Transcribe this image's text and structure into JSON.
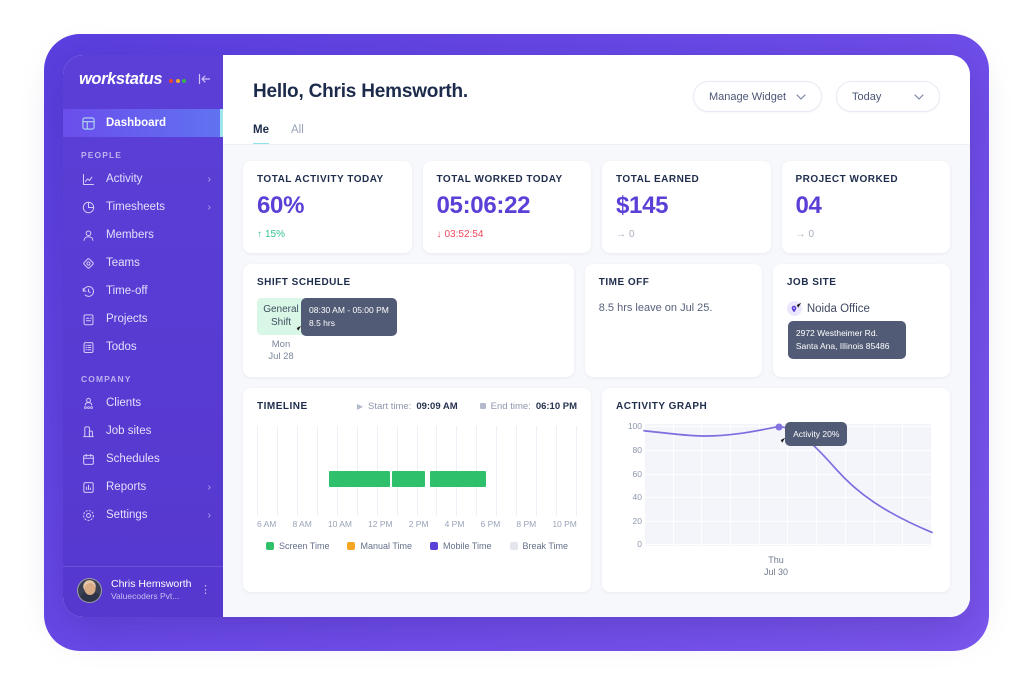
{
  "sidebar": {
    "brand": "workstatus",
    "brand_dot_colors": [
      "#e8452c",
      "#f0a72c",
      "#39b54a"
    ],
    "collapse_icon": "collapse-panel-icon",
    "active_item": "Dashboard",
    "items": [
      {
        "label": "Dashboard",
        "icon": "dashboard-icon",
        "active": true,
        "chevron": false
      },
      {
        "label": "Activity",
        "icon": "activity-chart-icon",
        "active": false,
        "chevron": true
      },
      {
        "label": "Timesheets",
        "icon": "pie-clock-icon",
        "active": false,
        "chevron": true
      },
      {
        "label": "Members",
        "icon": "user-icon",
        "active": false,
        "chevron": false
      },
      {
        "label": "Teams",
        "icon": "teams-icon",
        "active": false,
        "chevron": false
      },
      {
        "label": "Time-off",
        "icon": "clock-rewind-icon",
        "active": false,
        "chevron": false
      },
      {
        "label": "Projects",
        "icon": "clipboard-icon",
        "active": false,
        "chevron": false
      },
      {
        "label": "Todos",
        "icon": "list-icon",
        "active": false,
        "chevron": false
      },
      {
        "label": "Clients",
        "icon": "clients-icon",
        "active": false,
        "chevron": false
      },
      {
        "label": "Job sites",
        "icon": "building-icon",
        "active": false,
        "chevron": false
      },
      {
        "label": "Schedules",
        "icon": "calendar-icon",
        "active": false,
        "chevron": false
      },
      {
        "label": "Reports",
        "icon": "bar-report-icon",
        "active": false,
        "chevron": true
      },
      {
        "label": "Settings",
        "icon": "gear-icon",
        "active": false,
        "chevron": true
      }
    ],
    "sections": {
      "people": "PEOPLE",
      "company": "COMPANY"
    },
    "user": {
      "name": "Chris Hemsworth",
      "org": "Valuecoders Pvt...",
      "menu_icon": "more-vertical-icon"
    }
  },
  "header": {
    "greeting": "Hello, Chris Hemsworth.",
    "manage_widget": "Manage Widget",
    "date_range": "Today",
    "chevron_icon": "chevron-down-icon",
    "tabs": [
      {
        "label": "Me",
        "active": true
      },
      {
        "label": "All",
        "active": false
      }
    ]
  },
  "stats": [
    {
      "title": "TOTAL ACTIVITY TODAY",
      "value": "60%",
      "delta": "15%",
      "trend": "up"
    },
    {
      "title": "TOTAL WORKED TODAY",
      "value": "05:06:22",
      "delta": "03:52:54",
      "trend": "down"
    },
    {
      "title": "TOTAL EARNED",
      "value": "$145",
      "delta": "0",
      "trend": "flat"
    },
    {
      "title": "PROJECT WORKED",
      "value": "04",
      "delta": "0",
      "trend": "flat"
    }
  ],
  "shift_schedule": {
    "title": "SHIFT SCHEDULE",
    "chip_line1": "General",
    "chip_line2": "Shift",
    "day": "Mon",
    "date": "Jul 28",
    "tooltip_time": "08:30 AM - 05:00 PM",
    "tooltip_hours": "8.5 hrs"
  },
  "time_off": {
    "title": "TIME OFF",
    "text": "8.5 hrs leave on Jul 25."
  },
  "job_site": {
    "title": "JOB SITE",
    "pin_icon": "map-pin-icon",
    "name": "Noida Office",
    "address": "2972 Westheimer Rd. Santa Ana, Illinois 85486"
  },
  "timeline": {
    "title": "TIMELINE",
    "start_label": "Start time:",
    "start_value": "09:09 AM",
    "end_label": "End time:",
    "end_value": "06:10 PM",
    "start_icon": "play-icon",
    "end_icon": "stop-icon",
    "x_labels": [
      "6 AM",
      "8 AM",
      "10 AM",
      "12 PM",
      "2 PM",
      "4 PM",
      "6 PM",
      "8 PM",
      "10 PM"
    ],
    "legend": [
      {
        "label": "Screen Time",
        "color": "#2ec06a"
      },
      {
        "label": "Manual Time",
        "color": "#f5a623"
      },
      {
        "label": "Mobile Time",
        "color": "#5b3fd6"
      },
      {
        "label": "Break Time",
        "color": "#e4e6ee"
      }
    ],
    "segments": [
      {
        "start_pct": 22.5,
        "width_pct": 19.0,
        "color": "#2ec06a",
        "type": "Screen Time"
      },
      {
        "start_pct": 42.2,
        "width_pct": 10.4,
        "color": "#2ec06a",
        "type": "Screen Time"
      },
      {
        "start_pct": 54.0,
        "width_pct": 17.5,
        "color": "#2ec06a",
        "type": "Screen Time"
      }
    ]
  },
  "activity_graph": {
    "title": "ACTIVITY GRAPH",
    "tooltip": "Activity 20%",
    "x_day": "Thu",
    "x_date": "Jul 30"
  },
  "chart_data": [
    {
      "type": "area",
      "title": "ACTIVITY GRAPH",
      "xlabel": "",
      "ylabel": "",
      "ylim": [
        0,
        100
      ],
      "yticks": [
        100,
        80,
        60,
        40,
        20,
        0
      ],
      "grid": true,
      "legend": "none",
      "annotations": [
        {
          "text": "Activity 20%",
          "x_pct": 47,
          "y": 100
        }
      ],
      "x": [
        0,
        10,
        20,
        30,
        40,
        47,
        55,
        65,
        75,
        85,
        100
      ],
      "values": [
        96,
        93,
        92,
        93,
        96,
        100,
        92,
        66,
        40,
        22,
        5
      ],
      "series": [
        {
          "name": "Activity",
          "color": "#7b6ede",
          "values": [
            96,
            93,
            92,
            93,
            96,
            100,
            92,
            66,
            40,
            22,
            5
          ]
        }
      ],
      "tick_labels": {
        "x": [
          "Thu Jul 30"
        ]
      }
    },
    {
      "type": "bar",
      "title": "TIMELINE",
      "xlabel": "",
      "ylabel": "",
      "categories": [
        "6 AM",
        "8 AM",
        "10 AM",
        "12 PM",
        "2 PM",
        "4 PM",
        "6 PM",
        "8 PM",
        "10 PM"
      ],
      "grid": true,
      "legend": "bottom",
      "series": [
        {
          "name": "Screen Time",
          "color": "#2ec06a",
          "intervals": [
            [
              "9:09 AM",
              "12:30 PM"
            ],
            [
              "12:40 PM",
              "2:40 PM"
            ],
            [
              "3:00 PM",
              "5:30 PM"
            ]
          ]
        },
        {
          "name": "Manual Time",
          "color": "#f5a623",
          "intervals": []
        },
        {
          "name": "Mobile Time",
          "color": "#5b3fd6",
          "intervals": []
        },
        {
          "name": "Break Time",
          "color": "#e4e6ee",
          "intervals": [
            [
              "12:30 PM",
              "12:40 PM"
            ],
            [
              "2:40 PM",
              "3:00 PM"
            ]
          ]
        }
      ]
    }
  ]
}
